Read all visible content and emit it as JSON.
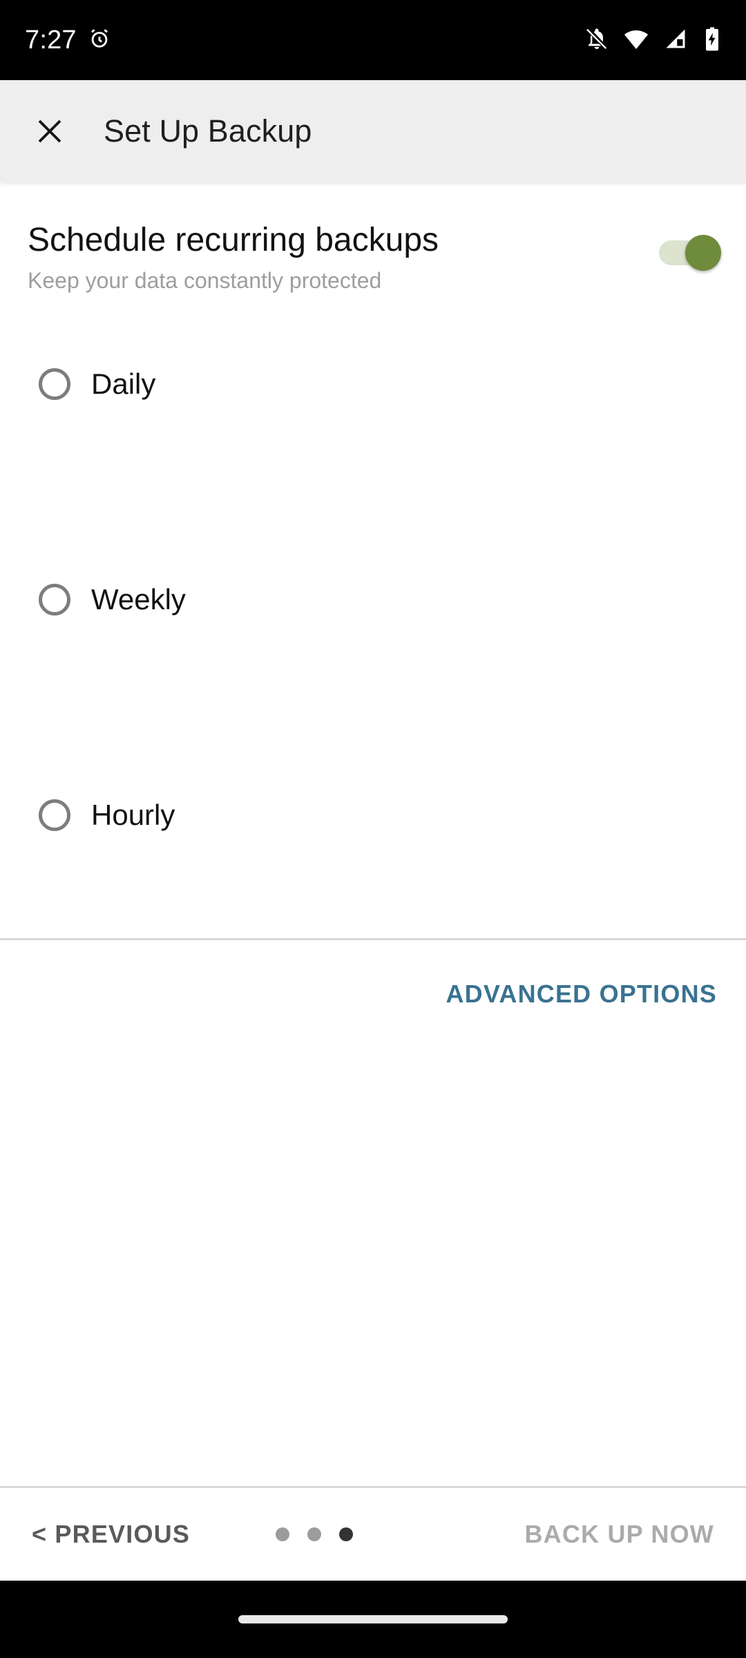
{
  "status_bar": {
    "time": "7:27",
    "icons": [
      "alarm-icon",
      "notifications-off-icon",
      "wifi-icon",
      "cellular-signal-icon",
      "battery-charging-icon"
    ]
  },
  "app_bar": {
    "close_label": "✕",
    "title": "Set Up Backup"
  },
  "schedule": {
    "title": "Schedule recurring backups",
    "subtitle": "Keep your data constantly protected",
    "toggle_on": true,
    "toggle_track_color": "#dce3cf",
    "toggle_thumb_color": "#6f8b3c"
  },
  "frequency_options": [
    {
      "label": "Daily",
      "selected": false
    },
    {
      "label": "Weekly",
      "selected": false
    },
    {
      "label": "Hourly",
      "selected": false
    }
  ],
  "advanced": {
    "label": "ADVANCED OPTIONS",
    "color": "#3a7291"
  },
  "bottom_bar": {
    "previous_label": "< PREVIOUS",
    "next_label": "BACK UP NOW",
    "next_enabled": false,
    "page_dots": {
      "total": 3,
      "active_index": 2
    }
  }
}
